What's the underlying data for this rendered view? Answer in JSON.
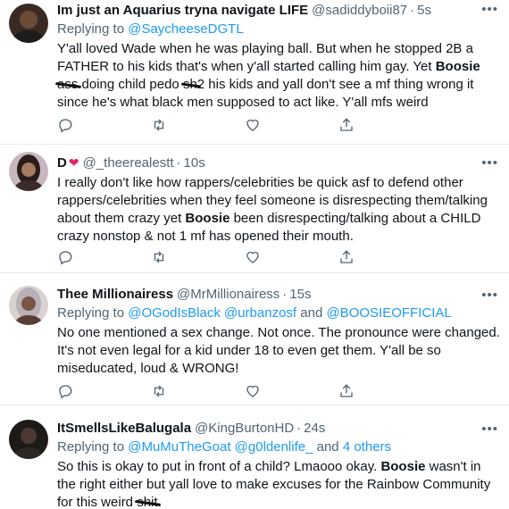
{
  "tweets": [
    {
      "name": "Im just an Aquarius tryna navigate LIFE",
      "handle": "@sadiddyboii87",
      "time": "5s",
      "reply_prefix": "Replying to ",
      "reply_to": "@SaycheeseDGTL",
      "reply_and": "",
      "reply_to_2": "",
      "body_1": "Y'all loved Wade when he was playing ball. But when he stopped 2B a FATHER to his kids that's when y'all started calling him gay. Yet ",
      "body_bold": "Boosie",
      "body_redact_1": "ass",
      "body_2": " doing child pedo ",
      "body_redact_2": "sh",
      "body_3": "2 his kids and yall don't see a mf thing wrong it since he's what black men supposed to act like. Y'all mfs weird"
    },
    {
      "name": "D",
      "heart": "❤",
      "handle": "@_theerealestt",
      "time": "10s",
      "body_1": "I really don't like how rappers/celebrities be quick asf to defend other rappers/celebrities when they feel someone is disrespecting them/talking about them crazy yet ",
      "body_bold": "Boosie",
      "body_2": " been disrespecting/talking about a CHILD crazy nonstop & not 1 mf has opened their mouth."
    },
    {
      "name": "Thee Millionairess",
      "handle": "@MrMillionairess",
      "time": "15s",
      "reply_prefix": "Replying to ",
      "reply_to": "@OGodIsBlack @urbanzosf",
      "reply_and": " and ",
      "reply_to_2": "@BOOSIEOFFICIAL",
      "body_1": "No one mentioned a sex change. Not once. The pronounce were changed. It's not even legal for a kid under 18 to even get them. Y'all be so miseducated, loud & WRONG!"
    },
    {
      "name": "ItSmellsLikeBalugala",
      "handle": "@KingBurtonHD",
      "time": "24s",
      "reply_prefix": "Replying to ",
      "reply_to": "@MuMuTheGoat @g0ldenlife_",
      "reply_and": " and ",
      "reply_to_2": "4 others",
      "body_1": "So this is okay to put in front of a child? Lmaooo okay. ",
      "body_bold": "Boosie",
      "body_2": " wasn't in the right either but yall love to make excuses for the Rainbow Community for this weird ",
      "body_redact": "shit",
      "body_3": "."
    }
  ],
  "icons": [
    "reply-icon",
    "retweet-icon",
    "like-icon",
    "share-icon",
    "more-icon"
  ],
  "colors": {
    "link": "#1d9bf0",
    "secondary": "#536471",
    "text": "#0f1419",
    "heart": "#e0245e"
  }
}
